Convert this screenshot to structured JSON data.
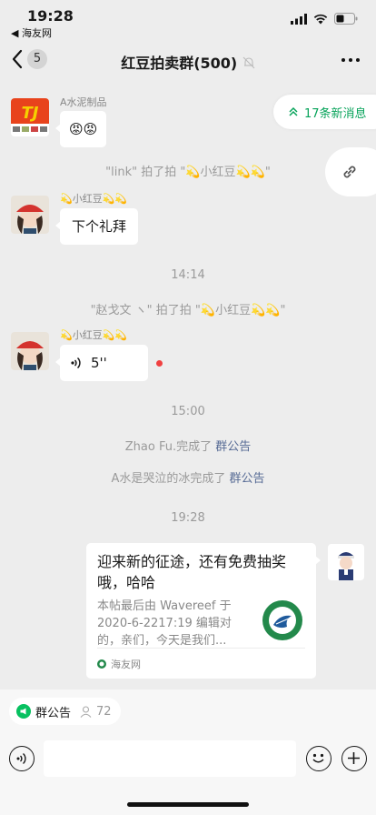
{
  "status": {
    "time": "19:28",
    "back_app": "◀ 海友网"
  },
  "nav": {
    "back_count": "5",
    "title": "红豆拍卖群(500)"
  },
  "new_messages": {
    "label": "17条新消息"
  },
  "messages": [
    {
      "type": "text",
      "sender": "A水泥制品",
      "text": "😡😡"
    },
    {
      "type": "system",
      "text": "\"link\" 拍了拍 \"💫小红豆💫💫\""
    },
    {
      "type": "text",
      "sender": "💫小红豆💫💫",
      "text": "下个礼拜"
    },
    {
      "type": "timestamp",
      "text": "14:14"
    },
    {
      "type": "system",
      "text": "\"赵戈文              ヽ\" 拍了拍 \"💫小红豆💫💫\""
    },
    {
      "type": "voice",
      "sender": "💫小红豆💫💫",
      "duration": "5''"
    },
    {
      "type": "timestamp",
      "text": "15:00"
    },
    {
      "type": "system",
      "actor": "Zhao Fu.完成了",
      "link": "群公告"
    },
    {
      "type": "system",
      "actor": "A水是哭泣的冰完成了",
      "link": "群公告"
    },
    {
      "type": "timestamp",
      "text": "19:28"
    },
    {
      "type": "card",
      "title": "迎来新的征途，还有免费抽奖哦，哈哈",
      "description": "本帖最后由 Wavereef 于 2020-6-2217:19 编辑对的，亲们，今天是我们...",
      "source": "海友网"
    }
  ],
  "bottom_bar": {
    "notice_label": "群公告",
    "member_count": "72"
  },
  "colors": {
    "accent_green": "#07a35a",
    "link_blue": "#576b95",
    "background": "#ededed",
    "unread_dot": "#f04040"
  }
}
